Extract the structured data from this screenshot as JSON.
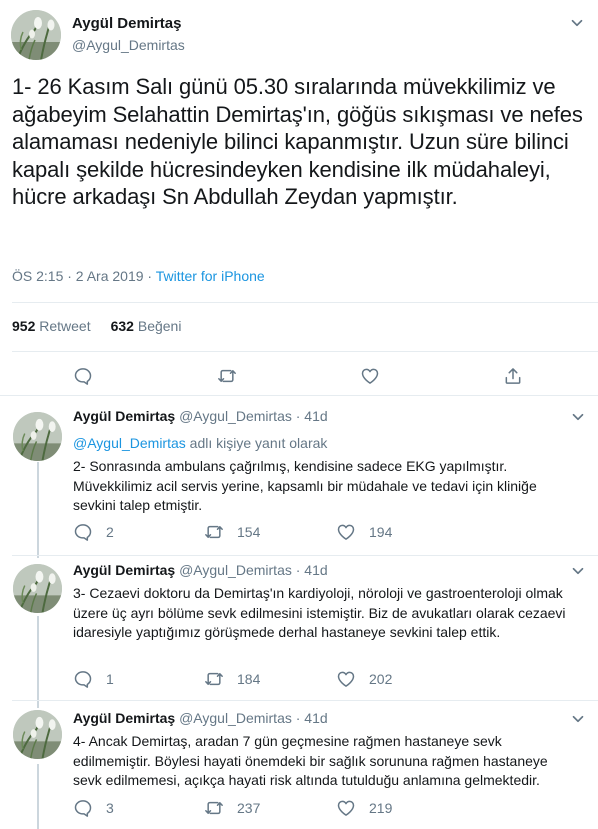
{
  "main_tweet": {
    "author_name": "Aygül Demirtaş",
    "author_handle": "@Aygul_Demirtas",
    "text": "1- 26 Kasım Salı günü 05.30 sıralarında müvekkilimiz ve ağabeyim Selahattin Demirtaş'ın, göğüs sıkışması ve nefes alamaması nedeniyle bilinci kapanmıştır. Uzun süre bilinci kapalı şekilde hücresindeyken kendisine ilk müdahaleyi, hücre arkadaşı Sn Abdullah Zeydan yapmıştır.",
    "timestamp": "ÖS 2:15 · 2 Ara 2019",
    "separator": " · ",
    "source": "Twitter for iPhone",
    "retweet_count": "952",
    "retweet_label": "Retweet",
    "like_count": "632",
    "like_label": "Beğeni"
  },
  "replies": [
    {
      "author_name": "Aygül Demirtaş",
      "author_handle": "@Aygul_Demirtas",
      "time": "· 41d",
      "replying_mention": "@Aygul_Demirtas",
      "replying_suffix": " adlı kişiye yanıt olarak",
      "text": "2- Sonrasında ambulans çağrılmış, kendisine sadece EKG yapılmıştır. Müvekkilimiz acil servis yerine, kapsamlı bir müdahale ve tedavi için kliniğe sevkini talep etmiştir.",
      "reply_count": "2",
      "retweet_count": "154",
      "like_count": "194"
    },
    {
      "author_name": "Aygül Demirtaş",
      "author_handle": "@Aygul_Demirtas",
      "time": "· 41d",
      "text": "3- Cezaevi doktoru da Demirtaş'ın kardiyoloji, nöroloji ve gastroenteroloji olmak üzere üç ayrı bölüme sevk edilmesini istemiştir. Biz de avukatları olarak cezaevi idaresiyle yaptığımız görüşmede derhal hastaneye sevkini talep ettik.",
      "reply_count": "1",
      "retweet_count": "184",
      "like_count": "202"
    },
    {
      "author_name": "Aygül Demirtaş",
      "author_handle": "@Aygul_Demirtas",
      "time": "· 41d",
      "text": "4- Ancak Demirtaş, aradan 7 gün geçmesine rağmen hastaneye sevk edilmemiştir. Böylesi hayati önemdeki bir sağlık sorununa rağmen hastaneye sevk edilmemesi, açıkça hayati risk altında tutulduğu anlamına gelmektedir.",
      "reply_count": "3",
      "retweet_count": "237",
      "like_count": "219"
    }
  ],
  "icons": {
    "caret": "chevron-down-icon",
    "reply": "reply-icon",
    "retweet": "retweet-icon",
    "like": "heart-icon",
    "share": "share-icon"
  },
  "colors": {
    "text": "#14171a",
    "secondary": "#657786",
    "link": "#1b95e0",
    "divider": "#e6ecf0"
  }
}
